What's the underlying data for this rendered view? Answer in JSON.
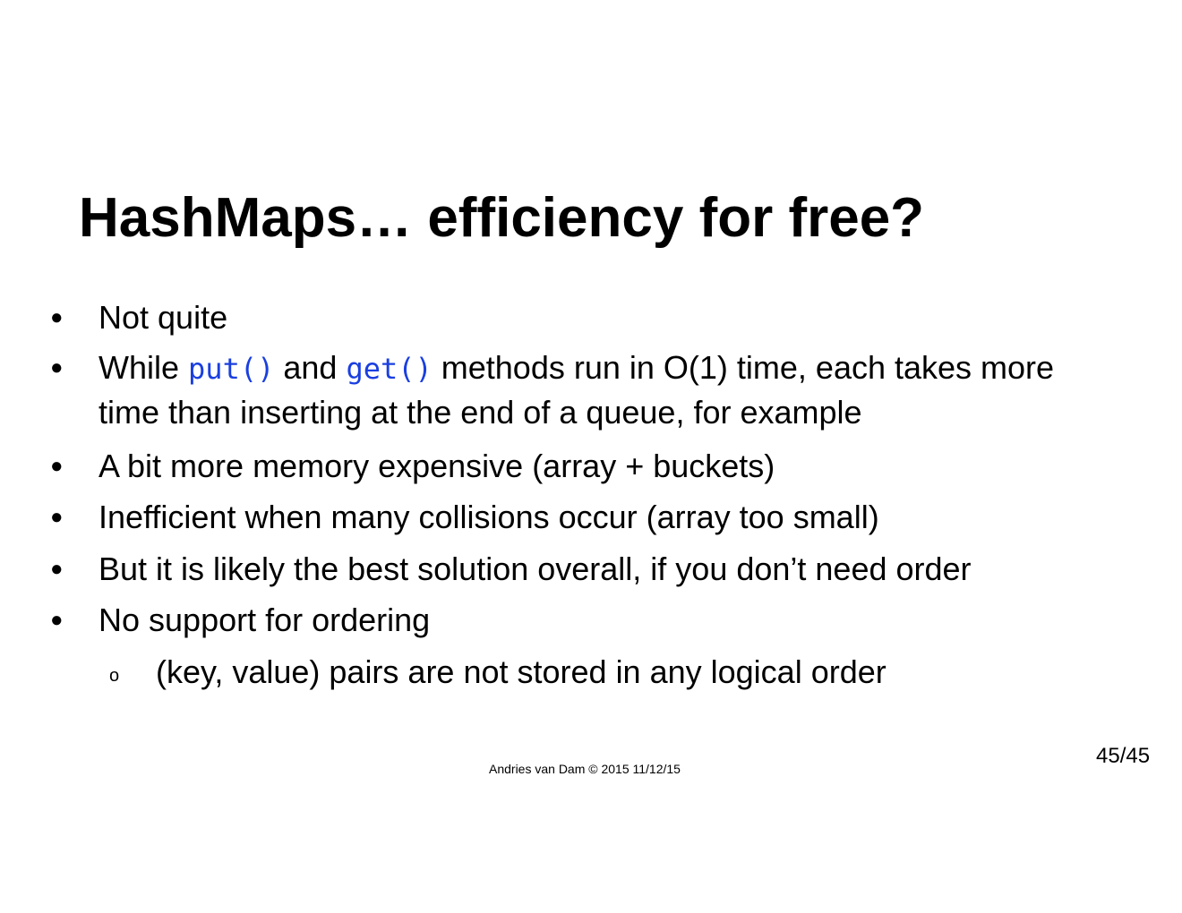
{
  "slide": {
    "title": "HashMaps… efficiency for free?",
    "bullets": [
      {
        "text": "Not quite"
      },
      {
        "part1": "While ",
        "code1": "put()",
        "part2": " and ",
        "code2": "get()",
        "part3": " methods run in O(1) time, each takes more",
        "line2": "time than inserting at the end of a queue, for example"
      },
      {
        "text": "A bit more memory expensive (array + buckets)"
      },
      {
        "text": "Inefficient when many collisions occur (array too small)"
      },
      {
        "text": "But it is likely the best solution overall, if you don’t need order"
      },
      {
        "text": "No support for ordering"
      }
    ],
    "sub_bullets": [
      {
        "text": "(key, value) pairs are not stored in any logical order"
      }
    ],
    "bullet_glyph": "●",
    "sub_bullet_glyph": "o",
    "code_color": "#1a3fe0"
  },
  "footer": {
    "credit": "Andries van Dam © 2015 11/12/15",
    "page_number": "45/45"
  }
}
